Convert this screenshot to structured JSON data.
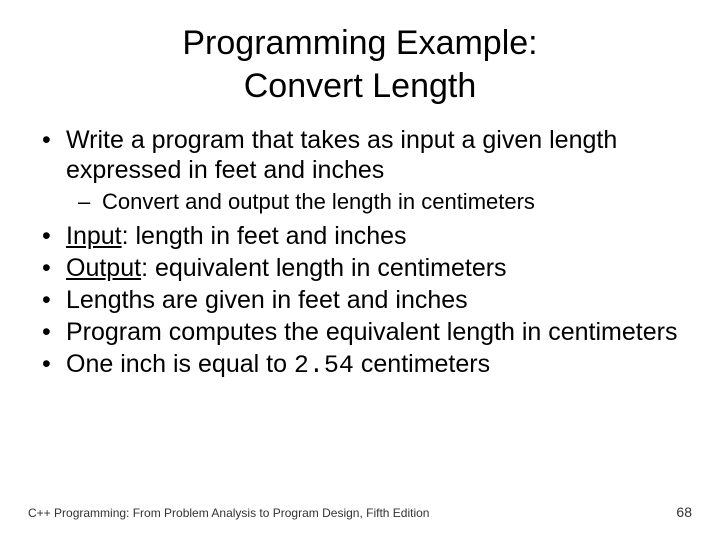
{
  "title_line1": "Programming Example:",
  "title_line2": "Convert Length",
  "bullets": {
    "b1": "Write a program that takes as input a given length expressed in feet and inches",
    "b1_sub": "Convert and output the length in centimeters",
    "b2_label": "Input",
    "b2_rest": ": length in feet and inches",
    "b3_label": "Output",
    "b3_rest": ": equivalent length in centimeters",
    "b4": "Lengths are given in feet and inches",
    "b5": "Program computes the equivalent length in centimeters",
    "b6_pre": "One inch is equal to ",
    "b6_code": "2.54",
    "b6_post": " centimeters"
  },
  "footer_left": "C++ Programming: From Problem Analysis to Program Design, Fifth Edition",
  "footer_right": "68"
}
